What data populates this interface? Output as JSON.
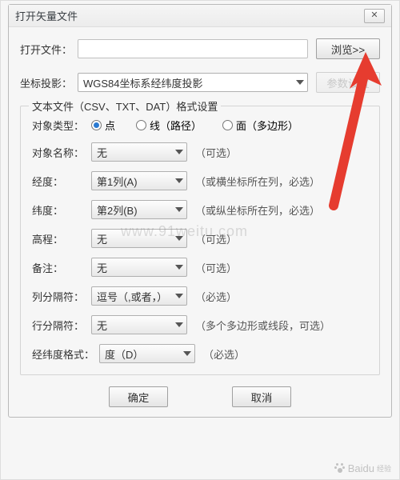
{
  "window": {
    "title": "打开矢量文件",
    "close_icon": "✕"
  },
  "open_file": {
    "label": "打开文件：",
    "value": "",
    "browse": "浏览>>"
  },
  "projection": {
    "label": "坐标投影：",
    "value": "WGS84坐标系经纬度投影",
    "params_btn": "参数设置"
  },
  "group": {
    "legend": "文本文件（CSV、TXT、DAT）格式设置",
    "object_type": {
      "label": "对象类型：",
      "point": "点",
      "line": "线（路径）",
      "polygon": "面（多边形）",
      "selected": "point"
    },
    "object_name": {
      "label": "对象名称：",
      "value": "无",
      "hint": "（可选）"
    },
    "longitude": {
      "label": "经度：",
      "value": "第1列(A)",
      "hint": "（或横坐标所在列，必选）"
    },
    "latitude": {
      "label": "纬度：",
      "value": "第2列(B)",
      "hint": "（或纵坐标所在列，必选）"
    },
    "elevation": {
      "label": "高程：",
      "value": "无",
      "hint": "（可选）"
    },
    "remark": {
      "label": "备注：",
      "value": "无",
      "hint": "（可选）"
    },
    "col_sep": {
      "label": "列分隔符：",
      "value": "逗号（,或者，）",
      "hint": "（必选）"
    },
    "row_sep": {
      "label": "行分隔符：",
      "value": "无",
      "hint": "（多个多边形或线段，可选）"
    },
    "coord_fmt": {
      "label": "经纬度格式：",
      "value": "度（D）",
      "hint": "（必选）"
    }
  },
  "footer": {
    "ok": "确定",
    "cancel": "取消"
  },
  "overlay": {
    "watermark": "www.91weitu.com",
    "logo_text": "Baidu",
    "logo_sub": "经验"
  }
}
